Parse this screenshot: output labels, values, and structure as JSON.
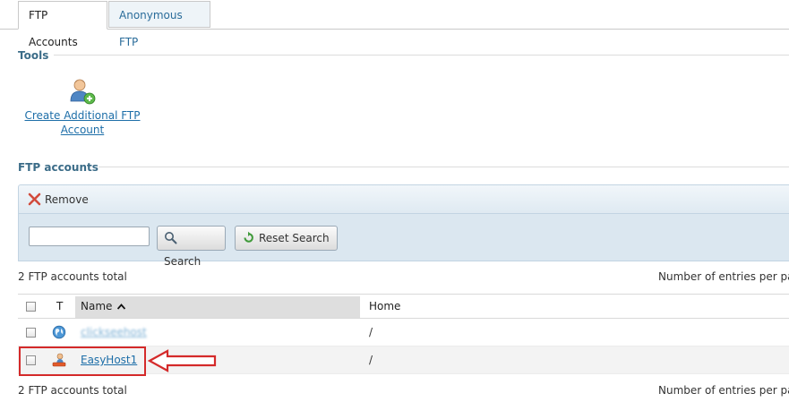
{
  "tabs": [
    {
      "label": "FTP Accounts",
      "active": true
    },
    {
      "label": "Anonymous FTP",
      "active": false
    }
  ],
  "tools_section": {
    "title": "Tools",
    "create_link": "Create Additional FTP Account",
    "create_icon": "user-add-icon"
  },
  "accounts_section": {
    "title": "FTP accounts",
    "remove_label": "Remove",
    "search_value": "",
    "search_button": "Search",
    "reset_button": "Reset Search",
    "total_top": "2 FTP accounts total",
    "total_bottom": "2 FTP accounts total",
    "per_page_label": "Number of entries per pa"
  },
  "table": {
    "columns": {
      "type": "T",
      "name": "Name",
      "home": "Home"
    },
    "sort": {
      "column": "Name",
      "direction": "ascending"
    },
    "rows": [
      {
        "name": "clickseehost",
        "home": "/",
        "icon": "globe-icon"
      },
      {
        "name": "EasyHost1",
        "home": "/",
        "icon": "ftp-user-icon"
      }
    ]
  },
  "colors": {
    "accent": "#1d6ea8",
    "section_title": "#3b6c88",
    "highlight": "#d42a2a"
  }
}
